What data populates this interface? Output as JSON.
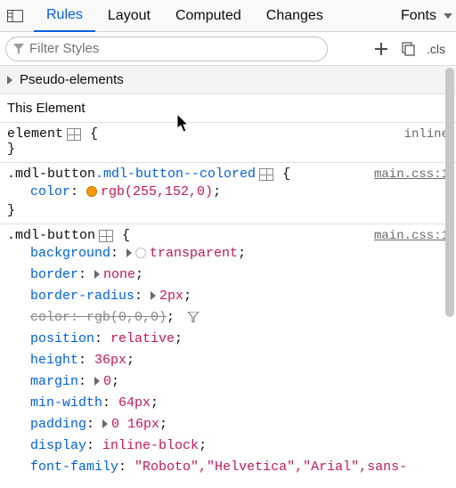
{
  "tabs": {
    "rules": "Rules",
    "layout": "Layout",
    "computed": "Computed",
    "changes": "Changes",
    "fonts": "Fonts"
  },
  "filter": {
    "placeholder": "Filter Styles"
  },
  "cls_label": ".cls",
  "pseudo_label": "Pseudo-elements",
  "this_element_label": "This Element",
  "inline_rule": {
    "selector": "element",
    "source": "inline"
  },
  "rule_colored": {
    "selector_a": ".mdl-button",
    "selector_b": ".mdl-button--colored",
    "source": "main.css:1",
    "decls": [
      {
        "prop": "color",
        "val": "rgb(255,152,0)",
        "swatch": "#ff9800"
      }
    ]
  },
  "rule_button": {
    "selector": ".mdl-button",
    "source": "main.css:1",
    "decls": {
      "background": {
        "prop": "background",
        "val": "transparent",
        "expander": true,
        "swatch": "white"
      },
      "border": {
        "prop": "border",
        "val": "none",
        "expander": true
      },
      "border_radius": {
        "prop": "border-radius",
        "val": "2px",
        "expander": true
      },
      "color": {
        "prop": "color",
        "val": "rgb(0,0,0)",
        "overridden": true,
        "filterable": true
      },
      "position": {
        "prop": "position",
        "val": "relative"
      },
      "height": {
        "prop": "height",
        "val": "36px"
      },
      "margin": {
        "prop": "margin",
        "val": "0",
        "expander": true
      },
      "min_width": {
        "prop": "min-width",
        "val": "64px"
      },
      "padding": {
        "prop": "padding",
        "val": "0 16px",
        "expander": true
      },
      "display": {
        "prop": "display",
        "val": "inline-block"
      },
      "font_family": {
        "prop": "font-family",
        "val": "\"Roboto\",\"Helvetica\",\"Arial\",sans-"
      }
    }
  }
}
